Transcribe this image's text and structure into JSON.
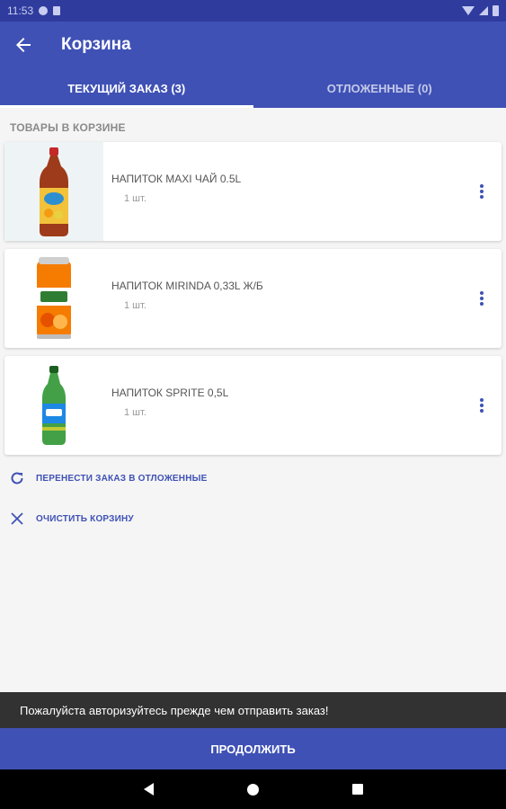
{
  "status_bar": {
    "time": "11:53"
  },
  "header": {
    "title": "Корзина"
  },
  "tabs": [
    {
      "label": "ТЕКУЩИЙ ЗАКАЗ (3)"
    },
    {
      "label": "ОТЛОЖЕННЫЕ (0)"
    }
  ],
  "cart": {
    "section_title": "ТОВАРЫ В КОРЗИНЕ",
    "items": [
      {
        "name": "НАПИТОК MAXI ЧАЙ 0.5L",
        "qty": "1 шт."
      },
      {
        "name": "НАПИТОК MIRINDA 0,33L Ж/Б",
        "qty": "1 шт."
      },
      {
        "name": "НАПИТОК SPRITE 0,5L",
        "qty": "1 шт."
      }
    ]
  },
  "actions": {
    "postpone": "ПЕРЕНЕСТИ ЗАКАЗ В ОТЛОЖЕННЫЕ",
    "clear": "ОЧИСТИТЬ КОРЗИНУ"
  },
  "snackbar": {
    "message": "Пожалуйста авторизуйтесь прежде чем отправить заказ!"
  },
  "continue_button": "ПРОДОЛЖИТЬ",
  "colors": {
    "primary": "#3f51b5",
    "status_bar": "#2f3c9e",
    "snackbar": "#323232"
  }
}
